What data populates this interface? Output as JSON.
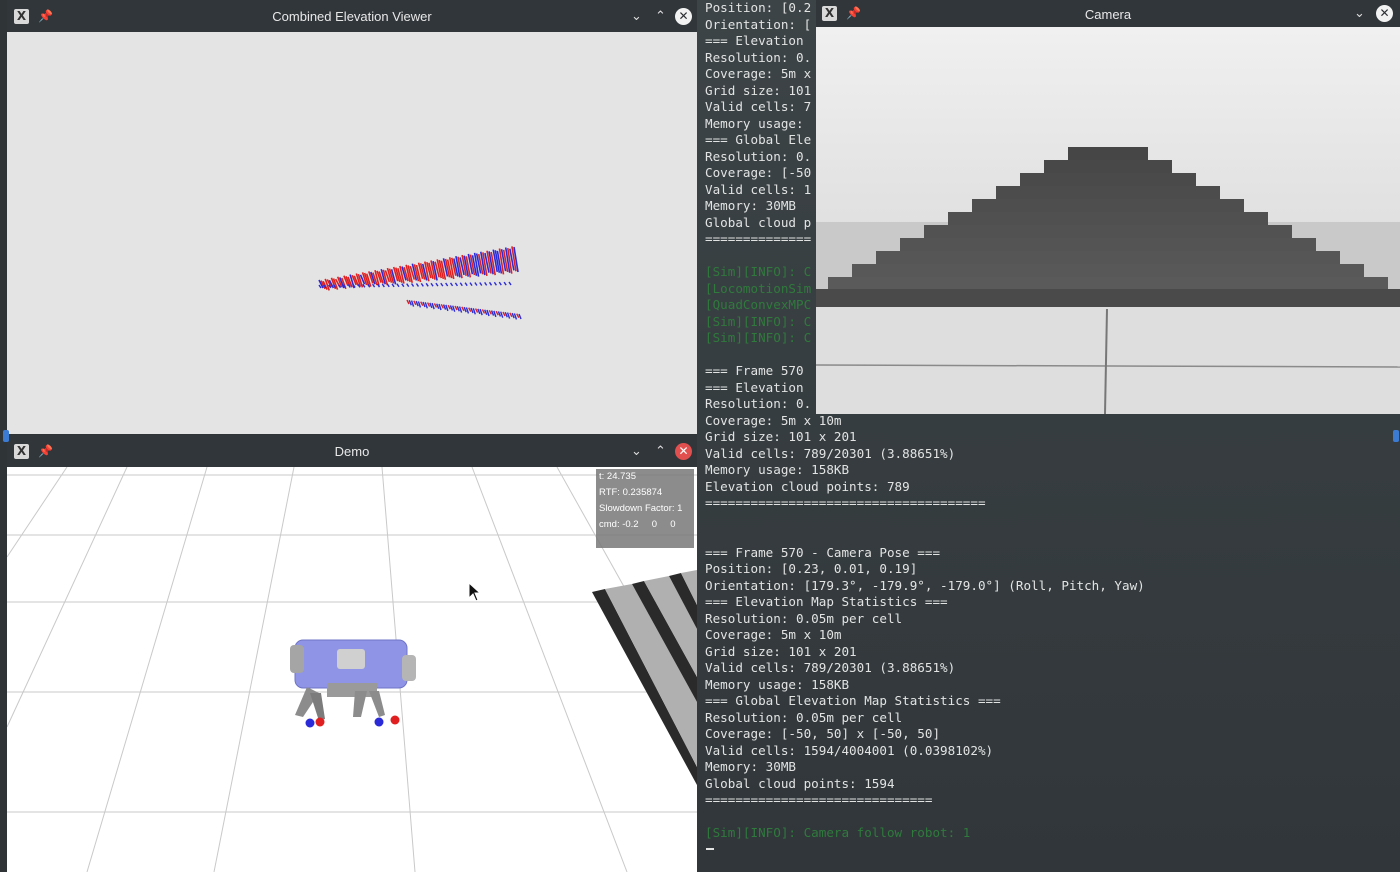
{
  "windows": {
    "elevation": {
      "title": "Combined Elevation Viewer"
    },
    "demo": {
      "title": "Demo",
      "hud": {
        "t": "t: 24.735",
        "rtf": "RTF: 0.235874",
        "slowdown": "Slowdown Factor: 1",
        "cmd": "cmd: -0.2     0     0"
      }
    },
    "camera": {
      "title": "Camera"
    }
  },
  "icons": {
    "app": "x11-logo-icon",
    "pin": "pin-icon",
    "minimize": "chevron-down-icon",
    "maximize": "chevron-up-icon",
    "close": "close-icon"
  },
  "colors": {
    "point_red": "#e02020",
    "point_blue": "#2a2ad8",
    "robot_body": "#8f94e6",
    "terminal_green": "#2f7a3c",
    "close_red": "#e24f4f"
  },
  "terminal": {
    "lines": [
      {
        "text": "Position: [0.2",
        "color": "white"
      },
      {
        "text": "Orientation: [",
        "color": "white"
      },
      {
        "text": "=== Elevation",
        "color": "white"
      },
      {
        "text": "Resolution: 0.",
        "color": "white"
      },
      {
        "text": "Coverage: 5m x",
        "color": "white"
      },
      {
        "text": "Grid size: 101",
        "color": "white"
      },
      {
        "text": "Valid cells: 7",
        "color": "white"
      },
      {
        "text": "Memory usage:",
        "color": "white"
      },
      {
        "text": "=== Global Ele",
        "color": "white"
      },
      {
        "text": "Resolution: 0.",
        "color": "white"
      },
      {
        "text": "Coverage: [-50",
        "color": "white"
      },
      {
        "text": "Valid cells: 1",
        "color": "white"
      },
      {
        "text": "Memory: 30MB",
        "color": "white"
      },
      {
        "text": "Global cloud p",
        "color": "white"
      },
      {
        "text": "==============",
        "color": "white"
      },
      {
        "text": "",
        "color": "white"
      },
      {
        "text": "[Sim][INFO]: C",
        "color": "green"
      },
      {
        "text": "[LocomotionSim",
        "color": "green"
      },
      {
        "text": "[QuadConvexMPC",
        "color": "green"
      },
      {
        "text": "[Sim][INFO]: C",
        "color": "green"
      },
      {
        "text": "[Sim][INFO]: C",
        "color": "green"
      },
      {
        "text": "",
        "color": "white"
      },
      {
        "text": "=== Frame 570",
        "color": "white"
      },
      {
        "text": "=== Elevation",
        "color": "white"
      },
      {
        "text": "Resolution: 0.",
        "color": "white"
      },
      {
        "text": "Coverage: 5m x 10m",
        "color": "white"
      },
      {
        "text": "Grid size: 101 x 201",
        "color": "white"
      },
      {
        "text": "Valid cells: 789/20301 (3.88651%)",
        "color": "white"
      },
      {
        "text": "Memory usage: 158KB",
        "color": "white"
      },
      {
        "text": "Elevation cloud points: 789",
        "color": "white"
      },
      {
        "text": "=====================================",
        "color": "white"
      },
      {
        "text": "",
        "color": "white"
      },
      {
        "text": "",
        "color": "white"
      },
      {
        "text": "=== Frame 570 - Camera Pose ===",
        "color": "white"
      },
      {
        "text": "Position: [0.23, 0.01, 0.19]",
        "color": "white"
      },
      {
        "text": "Orientation: [179.3°, -179.9°, -179.0°] (Roll, Pitch, Yaw)",
        "color": "white"
      },
      {
        "text": "=== Elevation Map Statistics ===",
        "color": "white"
      },
      {
        "text": "Resolution: 0.05m per cell",
        "color": "white"
      },
      {
        "text": "Coverage: 5m x 10m",
        "color": "white"
      },
      {
        "text": "Grid size: 101 x 201",
        "color": "white"
      },
      {
        "text": "Valid cells: 789/20301 (3.88651%)",
        "color": "white"
      },
      {
        "text": "Memory usage: 158KB",
        "color": "white"
      },
      {
        "text": "=== Global Elevation Map Statistics ===",
        "color": "white"
      },
      {
        "text": "Resolution: 0.05m per cell",
        "color": "white"
      },
      {
        "text": "Coverage: [-50, 50] x [-50, 50]",
        "color": "white"
      },
      {
        "text": "Valid cells: 1594/4004001 (0.0398102%)",
        "color": "white"
      },
      {
        "text": "Memory: 30MB",
        "color": "white"
      },
      {
        "text": "Global cloud points: 1594",
        "color": "white"
      },
      {
        "text": "==============================",
        "color": "white"
      },
      {
        "text": "",
        "color": "white"
      },
      {
        "text": "[Sim][INFO]: Camera follow robot: 1",
        "color": "green"
      }
    ]
  }
}
